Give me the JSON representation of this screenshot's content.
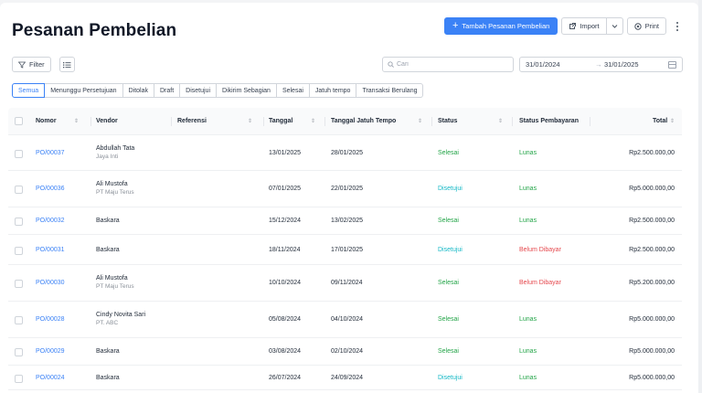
{
  "header": {
    "title": "Pesanan Pembelian",
    "add_label": "Tambah Pesanan Pembelian",
    "import_label": "Import",
    "print_label": "Print"
  },
  "toolbar": {
    "filter_label": "Filter",
    "search_placeholder": "Cari",
    "date_from": "31/01/2024",
    "date_to": "31/01/2025"
  },
  "tabs": [
    {
      "label": "Semua",
      "active": true
    },
    {
      "label": "Menunggu Persetujuan",
      "active": false
    },
    {
      "label": "Ditolak",
      "active": false
    },
    {
      "label": "Draft",
      "active": false
    },
    {
      "label": "Disetujui",
      "active": false
    },
    {
      "label": "Dikirim Sebagian",
      "active": false
    },
    {
      "label": "Selesai",
      "active": false
    },
    {
      "label": "Jatuh tempo",
      "active": false
    },
    {
      "label": "Transaksi Berulang",
      "active": false
    }
  ],
  "table": {
    "columns": {
      "nomor": "Nomor",
      "vendor": "Vendor",
      "referensi": "Referensi",
      "tanggal": "Tanggal",
      "jatuh_tempo": "Tanggal Jatuh Tempo",
      "status": "Status",
      "status_pembayaran": "Status Pembayaran",
      "total": "Total"
    },
    "rows": [
      {
        "nomor": "PO/00037",
        "vendor": "Abdullah Tata",
        "vendor_sub": "Jaya Inti",
        "tanggal": "13/01/2025",
        "jatuh_tempo": "28/01/2025",
        "status": "Selesai",
        "status_type": "done",
        "pembayaran": "Lunas",
        "pembayaran_type": "paid",
        "total": "Rp2.500.000,00"
      },
      {
        "nomor": "PO/00036",
        "vendor": "Ali Mustofa",
        "vendor_sub": "PT Maju Terus",
        "tanggal": "07/01/2025",
        "jatuh_tempo": "22/01/2025",
        "status": "Disetujui",
        "status_type": "approved",
        "pembayaran": "Lunas",
        "pembayaran_type": "paid",
        "total": "Rp5.000.000,00"
      },
      {
        "nomor": "PO/00032",
        "vendor": "Baskara",
        "vendor_sub": "",
        "tanggal": "15/12/2024",
        "jatuh_tempo": "13/02/2025",
        "status": "Selesai",
        "status_type": "done",
        "pembayaran": "Lunas",
        "pembayaran_type": "paid",
        "total": "Rp2.500.000,00"
      },
      {
        "nomor": "PO/00031",
        "vendor": "Baskara",
        "vendor_sub": "",
        "tanggal": "18/11/2024",
        "jatuh_tempo": "17/01/2025",
        "status": "Disetujui",
        "status_type": "approved",
        "pembayaran": "Belum Dibayar",
        "pembayaran_type": "unpaid",
        "total": "Rp2.500.000,00"
      },
      {
        "nomor": "PO/00030",
        "vendor": "Ali Mustofa",
        "vendor_sub": "PT Maju Terus",
        "tanggal": "10/10/2024",
        "jatuh_tempo": "09/11/2024",
        "status": "Selesai",
        "status_type": "done",
        "pembayaran": "Belum Dibayar",
        "pembayaran_type": "unpaid",
        "total": "Rp5.200.000,00"
      },
      {
        "nomor": "PO/00028",
        "vendor": "Cindy Novita Sari",
        "vendor_sub": "PT. ABC",
        "tanggal": "05/08/2024",
        "jatuh_tempo": "04/10/2024",
        "status": "Selesai",
        "status_type": "done",
        "pembayaran": "Lunas",
        "pembayaran_type": "paid",
        "total": "Rp5.000.000,00"
      },
      {
        "nomor": "PO/00029",
        "vendor": "Baskara",
        "vendor_sub": "",
        "tanggal": "03/08/2024",
        "jatuh_tempo": "02/10/2024",
        "status": "Selesai",
        "status_type": "done",
        "pembayaran": "Lunas",
        "pembayaran_type": "paid",
        "total": "Rp5.000.000,00"
      },
      {
        "nomor": "PO/00024",
        "vendor": "Baskara",
        "vendor_sub": "",
        "tanggal": "26/07/2024",
        "jatuh_tempo": "24/09/2024",
        "status": "Disetujui",
        "status_type": "approved",
        "pembayaran": "Lunas",
        "pembayaran_type": "paid",
        "total": "Rp5.000.000,00"
      }
    ]
  },
  "colors": {
    "primary": "#3b82f6",
    "status_done": "#22a447",
    "status_approved": "#14b8c6",
    "unpaid": "#e5484d"
  },
  "icons": {
    "add": "plus-icon",
    "import": "import-icon",
    "print": "print-icon",
    "more": "kebab-icon",
    "filter": "funnel-icon",
    "list": "list-icon",
    "search": "search-icon",
    "calendar": "calendar-icon"
  }
}
